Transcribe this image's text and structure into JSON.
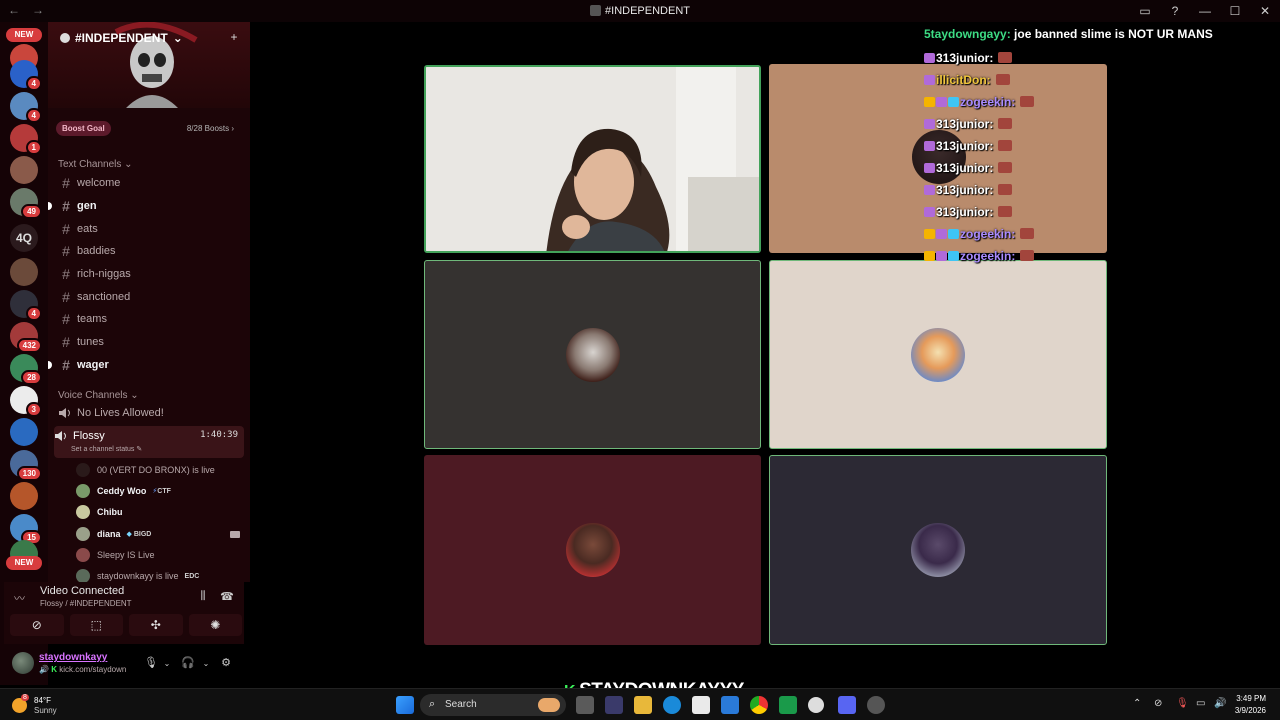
{
  "window": {
    "title": "#INDEPENDENT",
    "back": "←",
    "forward": "→"
  },
  "rail": {
    "new_top": "NEW",
    "new_bottom": "NEW",
    "text_server": "4Q",
    "badges": [
      "4",
      "4",
      "1",
      "49",
      "4",
      "432",
      "28",
      "3",
      "130",
      "15"
    ]
  },
  "server": {
    "name": "#INDEPENDENT",
    "boost_goal": "Boost Goal",
    "boost_count": "8/28 Boosts"
  },
  "text_channels": {
    "header": "Text Channels",
    "items": [
      {
        "name": "welcome",
        "unread": false
      },
      {
        "name": "gen",
        "unread": true
      },
      {
        "name": "eats",
        "unread": false
      },
      {
        "name": "baddies",
        "unread": false
      },
      {
        "name": "rich-niggas",
        "unread": false
      },
      {
        "name": "sanctioned",
        "unread": false
      },
      {
        "name": "teams",
        "unread": false
      },
      {
        "name": "tunes",
        "unread": false
      },
      {
        "name": "wager",
        "unread": true
      }
    ]
  },
  "voice_channels": {
    "header": "Voice Channels",
    "locked": "No Lives Allowed!",
    "active": {
      "name": "Flossy",
      "timer": "1:40:39",
      "status": "Set a channel status"
    },
    "members": [
      {
        "name": "00 (VERT DO BRONX) is live",
        "bold": false,
        "tag": ""
      },
      {
        "name": "Ceddy Woo",
        "bold": true,
        "tag": "CTF"
      },
      {
        "name": "Chibu",
        "bold": true,
        "tag": ""
      },
      {
        "name": "diana",
        "bold": true,
        "tag": "BIGD"
      },
      {
        "name": "Sleepy IS Live",
        "bold": false,
        "tag": ""
      },
      {
        "name": "staydownkayy is live",
        "bold": false,
        "tag": "EDC"
      }
    ]
  },
  "voice_panel": {
    "status": "Video Connected",
    "location": "Flossy / #INDEPENDENT"
  },
  "user": {
    "name": "staydownkayy",
    "status": "kick.com/staydown"
  },
  "chat": [
    {
      "user": "5taydowngayy:",
      "user_color": "#3ddc84",
      "text": " joe banned slime is NOT UR MANS",
      "badges": [],
      "emote": false
    },
    {
      "user": "313junior:",
      "user_color": "#ffffff",
      "text": "",
      "badges": [
        "#b06ad9"
      ],
      "emote": true
    },
    {
      "user": "illicitDon:",
      "user_color": "#f0c63c",
      "text": "",
      "badges": [
        "#b06ad9"
      ],
      "emote": true
    },
    {
      "user": "zogeekin:",
      "user_color": "#a98bff",
      "text": "",
      "badges": [
        "#f5b400",
        "#b06ad9",
        "#3ec5f5"
      ],
      "emote": true
    },
    {
      "user": "313junior:",
      "user_color": "#ffffff",
      "text": "",
      "badges": [
        "#b06ad9"
      ],
      "emote": true
    },
    {
      "user": "313junior:",
      "user_color": "#ffffff",
      "text": "",
      "badges": [
        "#b06ad9"
      ],
      "emote": true
    },
    {
      "user": "313junior:",
      "user_color": "#ffffff",
      "text": "",
      "badges": [
        "#b06ad9"
      ],
      "emote": true
    },
    {
      "user": "313junior:",
      "user_color": "#ffffff",
      "text": "",
      "badges": [
        "#b06ad9"
      ],
      "emote": true
    },
    {
      "user": "313junior:",
      "user_color": "#ffffff",
      "text": "",
      "badges": [
        "#b06ad9"
      ],
      "emote": true
    },
    {
      "user": "zogeekin:",
      "user_color": "#a98bff",
      "text": "",
      "badges": [
        "#f5b400",
        "#b06ad9",
        "#3ec5f5"
      ],
      "emote": true
    },
    {
      "user": "zogeekin:",
      "user_color": "#a98bff",
      "text": "",
      "badges": [
        "#f5b400",
        "#b06ad9",
        "#3ec5f5"
      ],
      "emote": true
    }
  ],
  "stream": {
    "watermark": "STAYDOWNKAYYY"
  },
  "taskbar": {
    "temperature": "84°F",
    "condition": "Sunny",
    "weather_badge": "8",
    "search": "Search",
    "time": "3:49 PM",
    "date": "3/9/2026"
  },
  "colors": {
    "speaking_border": "#43a25a",
    "tile_dark": "#353230",
    "tile_beige": "#e0d5cb",
    "tile_maroon": "#4d1a23",
    "tile_navy": "#2c2934",
    "tile_tan": "#b98b6c"
  }
}
